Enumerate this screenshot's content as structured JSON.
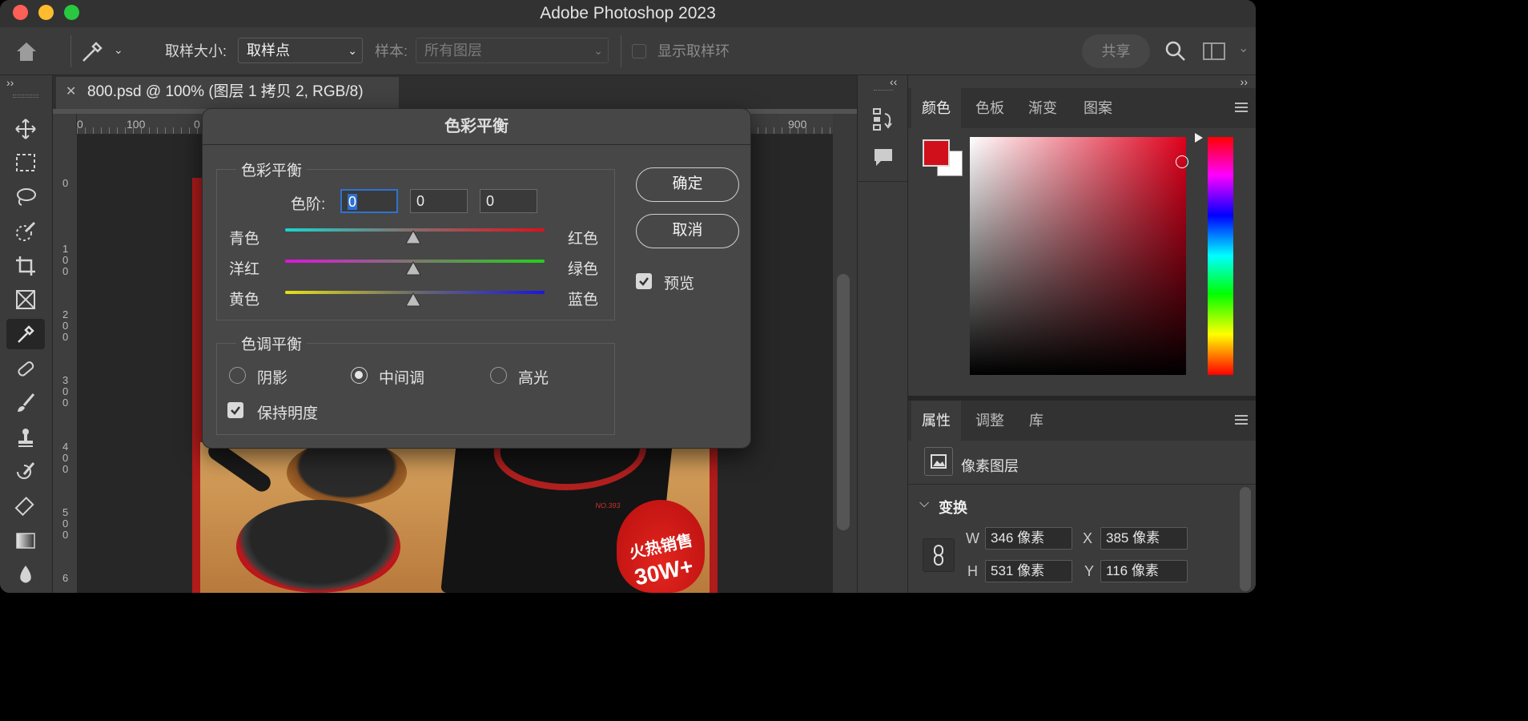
{
  "window": {
    "title": "Adobe Photoshop 2023"
  },
  "options_bar": {
    "sample_size_label": "取样大小:",
    "sample_size_value": "取样点",
    "sample_label": "样本:",
    "sample_value": "所有图层",
    "show_ring_label": "显示取样环",
    "share_label": "共享"
  },
  "document": {
    "tab_title": "800.psd @ 100% (图层 1 拷贝 2, RGB/8)",
    "ruler_h": [
      "0",
      "100",
      "0",
      "900"
    ],
    "ruler_v": [
      "0",
      "1\n0\n0",
      "2\n0\n0",
      "3\n0\n0",
      "4\n0\n0",
      "5\n0\n0",
      "6"
    ]
  },
  "canvas_art": {
    "promo_line1": "火热销售",
    "promo_line2": "30W+",
    "device_label": "NO.393"
  },
  "dialog": {
    "title": "色彩平衡",
    "group_color_balance": "色彩平衡",
    "levels_label": "色阶:",
    "levels": [
      "0",
      "0",
      "0"
    ],
    "sliders": [
      {
        "left": "青色",
        "right": "红色",
        "value": 0
      },
      {
        "left": "洋红",
        "right": "绿色",
        "value": 0
      },
      {
        "left": "黄色",
        "right": "蓝色",
        "value": 0
      }
    ],
    "group_tone_balance": "色调平衡",
    "tones": [
      "阴影",
      "中间调",
      "高光"
    ],
    "selected_tone": "中间调",
    "preserve_luminosity": "保持明度",
    "preserve_luminosity_checked": true,
    "ok_label": "确定",
    "cancel_label": "取消",
    "preview_label": "预览",
    "preview_checked": true
  },
  "color_panel": {
    "tabs": [
      "颜色",
      "色板",
      "渐变",
      "图案"
    ],
    "active_tab": "颜色",
    "foreground_color": "#d0101a",
    "background_color": "#ffffff"
  },
  "properties_panel": {
    "tabs": [
      "属性",
      "调整",
      "库"
    ],
    "active_tab": "属性",
    "layer_type": "像素图层",
    "section": "变换",
    "w_label": "W",
    "w_value": "346 像素",
    "h_label": "H",
    "h_value": "531 像素",
    "x_label": "X",
    "x_value": "385 像素",
    "y_label": "Y",
    "y_value": "116 像素"
  }
}
